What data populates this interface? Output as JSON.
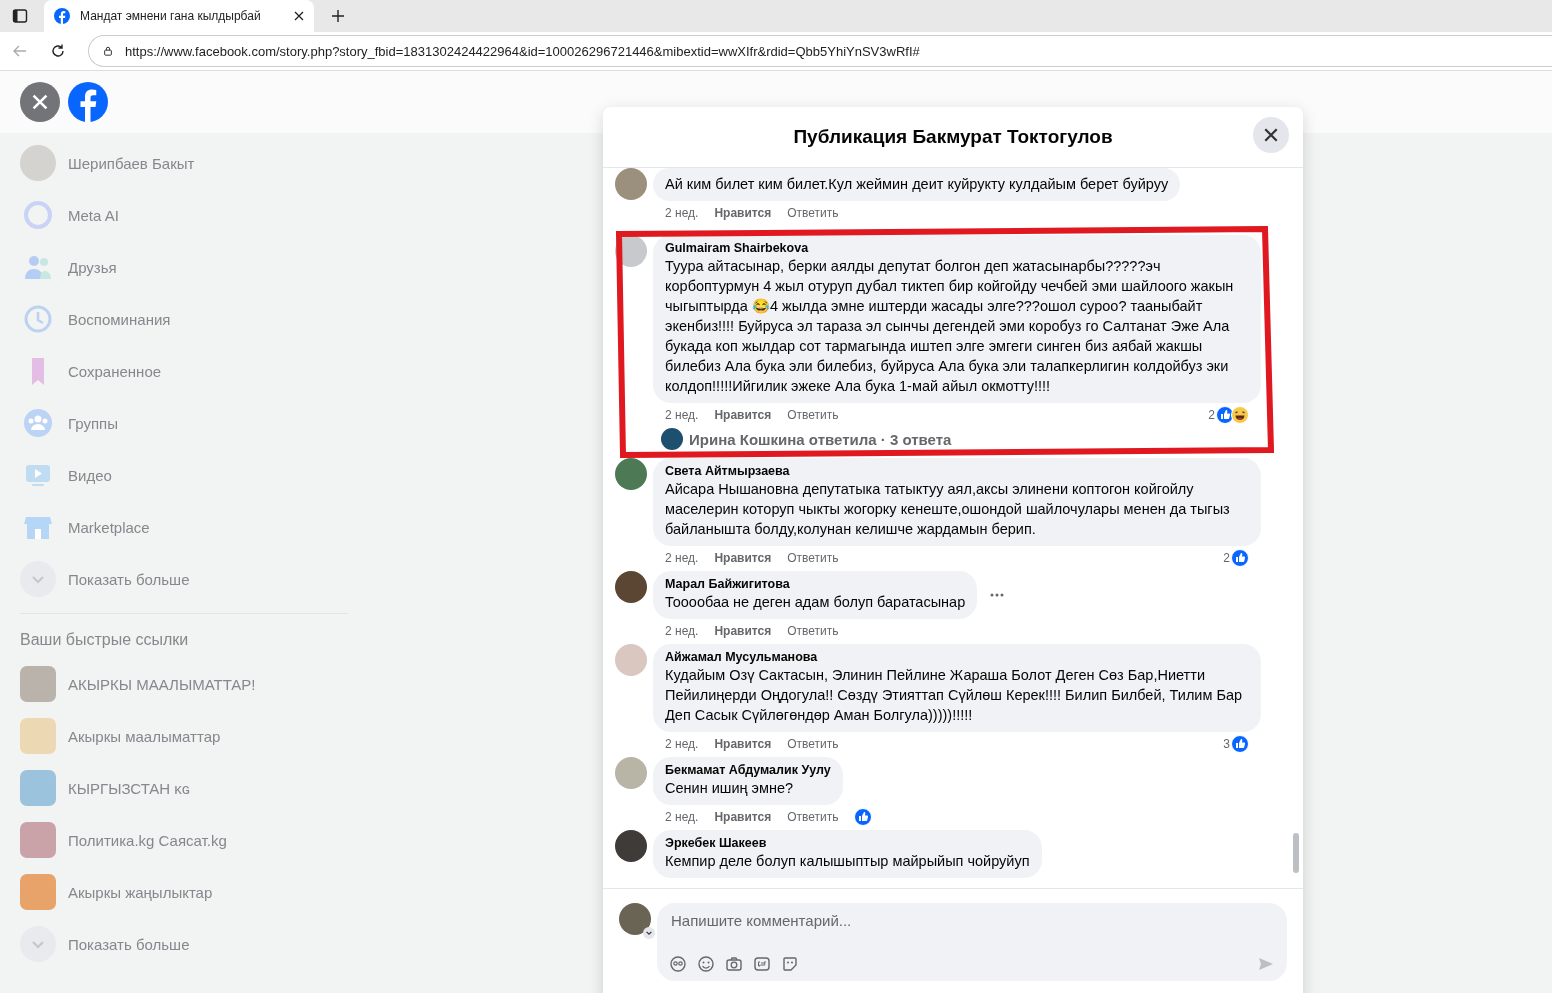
{
  "browser": {
    "tab_title": "Мандат эмнени гана кылдырбай",
    "url": "https://www.facebook.com/story.php?story_fbid=1831302424422964&id=100026296721446&mibextid=wwXIfr&rdid=Qbb5YhiYnSV3wRfI#"
  },
  "sidebar": {
    "items": [
      {
        "label": "Шерипбаев Бакыт",
        "kind": "avatar"
      },
      {
        "label": "Meta AI",
        "kind": "meta"
      },
      {
        "label": "Друзья",
        "kind": "friends"
      },
      {
        "label": "Воспоминания",
        "kind": "memories"
      },
      {
        "label": "Сохраненное",
        "kind": "saved"
      },
      {
        "label": "Группы",
        "kind": "groups"
      },
      {
        "label": "Видео",
        "kind": "video"
      },
      {
        "label": "Marketplace",
        "kind": "market"
      },
      {
        "label": "Показать больше",
        "kind": "more"
      }
    ],
    "section_title": "Ваши быстрые ссылки",
    "shortcuts": [
      {
        "label": "АКЫРКЫ МААЛЫМАТТАР!",
        "kind": "page",
        "color": "#b9b3ab"
      },
      {
        "label": "Акыркы маалыматтар",
        "kind": "page",
        "color": "#ecd9b4"
      },
      {
        "label": "КЫРГЫЗСТАН ᴋɢ",
        "kind": "page",
        "color": "#9cc3dd"
      },
      {
        "label": "Политика.kg Саясат.kg",
        "kind": "page",
        "color": "#c9a3a8"
      },
      {
        "label": "Акыркы жаңылыктар",
        "kind": "page",
        "color": "#e8a36a"
      },
      {
        "label": "Показать больше",
        "kind": "more"
      }
    ]
  },
  "modal": {
    "title": "Публикация Бакмурат Токтогулов",
    "comments": [
      {
        "text": "Ай ким билет ким билет.Кул жеймин деит куйрукту кулдайым берет буйруу",
        "time": "2 нед.",
        "like": "Нравится",
        "reply": "Ответить"
      },
      {
        "author": "Gulmairam Shairbekova",
        "text": "Туура айтасынар, берки аялды депутат болгон деп жатасынарбы?????эч корбоптурмун 4 жыл отуруп дубал тиктеп бир койгойду чечбей эми шайлоого жакын чыгыптырда 😂4 жылда эмне иштерди жасады элге???ошол суроо? тааныбайт экенбиз!!!! Буйруса эл тараза эл сынчы дегендей эми коробуз го Салтанат Эже Ала букада коп жылдар сот тармагында иштеп элге эмгеги синген биз аябай жакшы билебиз Ала бука эли билебиз, буйруса Ала бука эли талапкерлигин колдойбуз эки колдоп!!!!!Ийгилик эжеке Ала бука 1-май айыл окмотту!!!!",
        "time": "2 нед.",
        "like": "Нравится",
        "reply": "Ответить",
        "highlighted": true,
        "count": "2",
        "like_reaction": true,
        "haha_reaction": true,
        "replies": "Ирина Кошкина ответила · 3 ответа"
      },
      {
        "author": "Света Айтмырзаева",
        "text": "Айсара Нышановна депутатыка татыктуу аял,аксы элинени коптогон койгойлу маселерин которуп чыкты жогорку кенеште,ошондой шайлочулары менен да тыгыз байланышта болду,колунан келишче жардамын берип.",
        "time": "2 нед.",
        "like": "Нравится",
        "reply": "Ответить",
        "count": "2",
        "like_reaction": true
      },
      {
        "author": "Марал Байжигитова",
        "text": "Тооообаа не деген адам болуп баратасынар",
        "time": "2 нед.",
        "like": "Нравится",
        "reply": "Ответить",
        "more": true
      },
      {
        "author": "Айжамал Мусульманова",
        "text": "Кудайым Озү Сактасын, Элинин Пейлине Жараша Болот Деген Сөз Бар,Ниетти Пейилиңерди Оңдогула!! Сөздү Этияттап Сүйлөш Керек!!!! Билип Билбей, Тилим Бар Деп Сасык Сүйлөгөндөр Аман Болгула)))))!!!!!",
        "time": "2 нед.",
        "like": "Нравится",
        "reply": "Ответить",
        "count": "3",
        "like_reaction": true
      },
      {
        "author": "Бекмамат Абдумалик Уулу",
        "text": "Сенин ишиң эмне?",
        "time": "2 нед.",
        "like": "Нравится",
        "reply": "Ответить",
        "inline_reaction": true,
        "like_reaction": true
      },
      {
        "author": "Эркебек Шакеев",
        "text": "Кемпир деле болуп калышыптыр майрыйып чойруйуп"
      }
    ],
    "composer": {
      "placeholder": "Напишите комментарий..."
    }
  }
}
